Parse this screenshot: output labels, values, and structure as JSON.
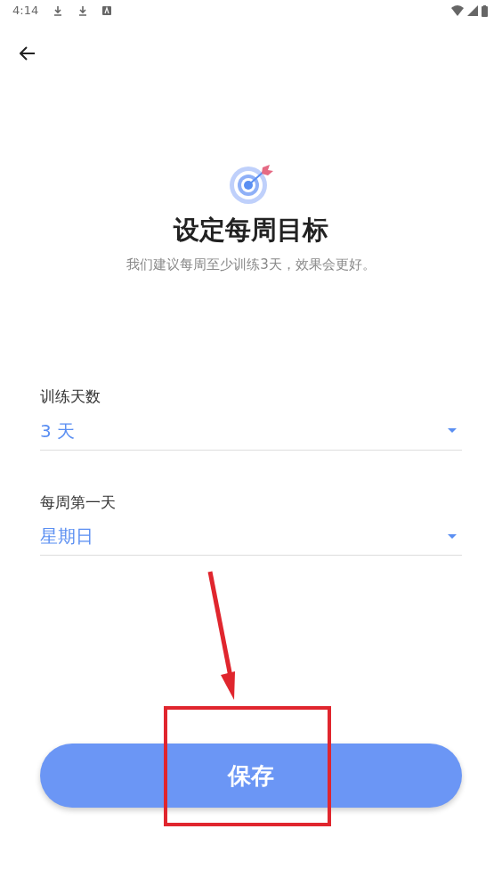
{
  "status_bar": {
    "time": "4:14"
  },
  "header": {
    "title": "设定每周目标",
    "subtitle": "我们建议每周至少训练3天，效果会更好。"
  },
  "fields": [
    {
      "label": "训练天数",
      "value": "3 天"
    },
    {
      "label": "每周第一天",
      "value": "星期日"
    }
  ],
  "save_button": {
    "label": "保存"
  }
}
